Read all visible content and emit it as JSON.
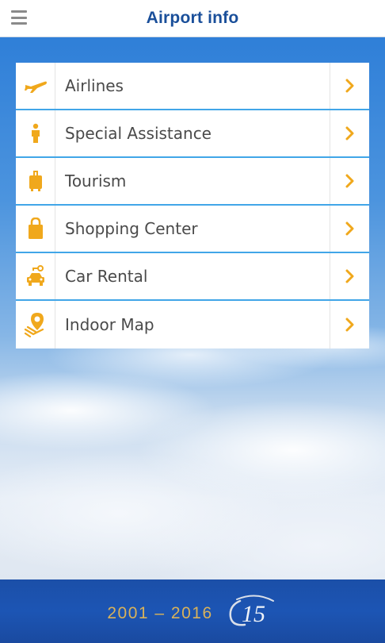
{
  "header": {
    "title": "Airport info",
    "menu_icon": "hamburger-menu-icon"
  },
  "menu": {
    "items": [
      {
        "label": "Airlines",
        "icon": "airplane-icon"
      },
      {
        "label": "Special Assistance",
        "icon": "person-icon"
      },
      {
        "label": "Tourism",
        "icon": "suitcase-icon"
      },
      {
        "label": "Shopping Center",
        "icon": "shopping-bag-icon"
      },
      {
        "label": "Car Rental",
        "icon": "car-icon"
      },
      {
        "label": "Indoor Map",
        "icon": "map-pin-icon"
      }
    ],
    "chevron_icon": "chevron-right-icon"
  },
  "footer": {
    "years": "2001 – 2016",
    "logo_text": "15"
  },
  "colors": {
    "accent": "#f0a81c",
    "title": "#1a4f9a",
    "divider": "#41a6e8",
    "footer": "#1c55b4"
  }
}
